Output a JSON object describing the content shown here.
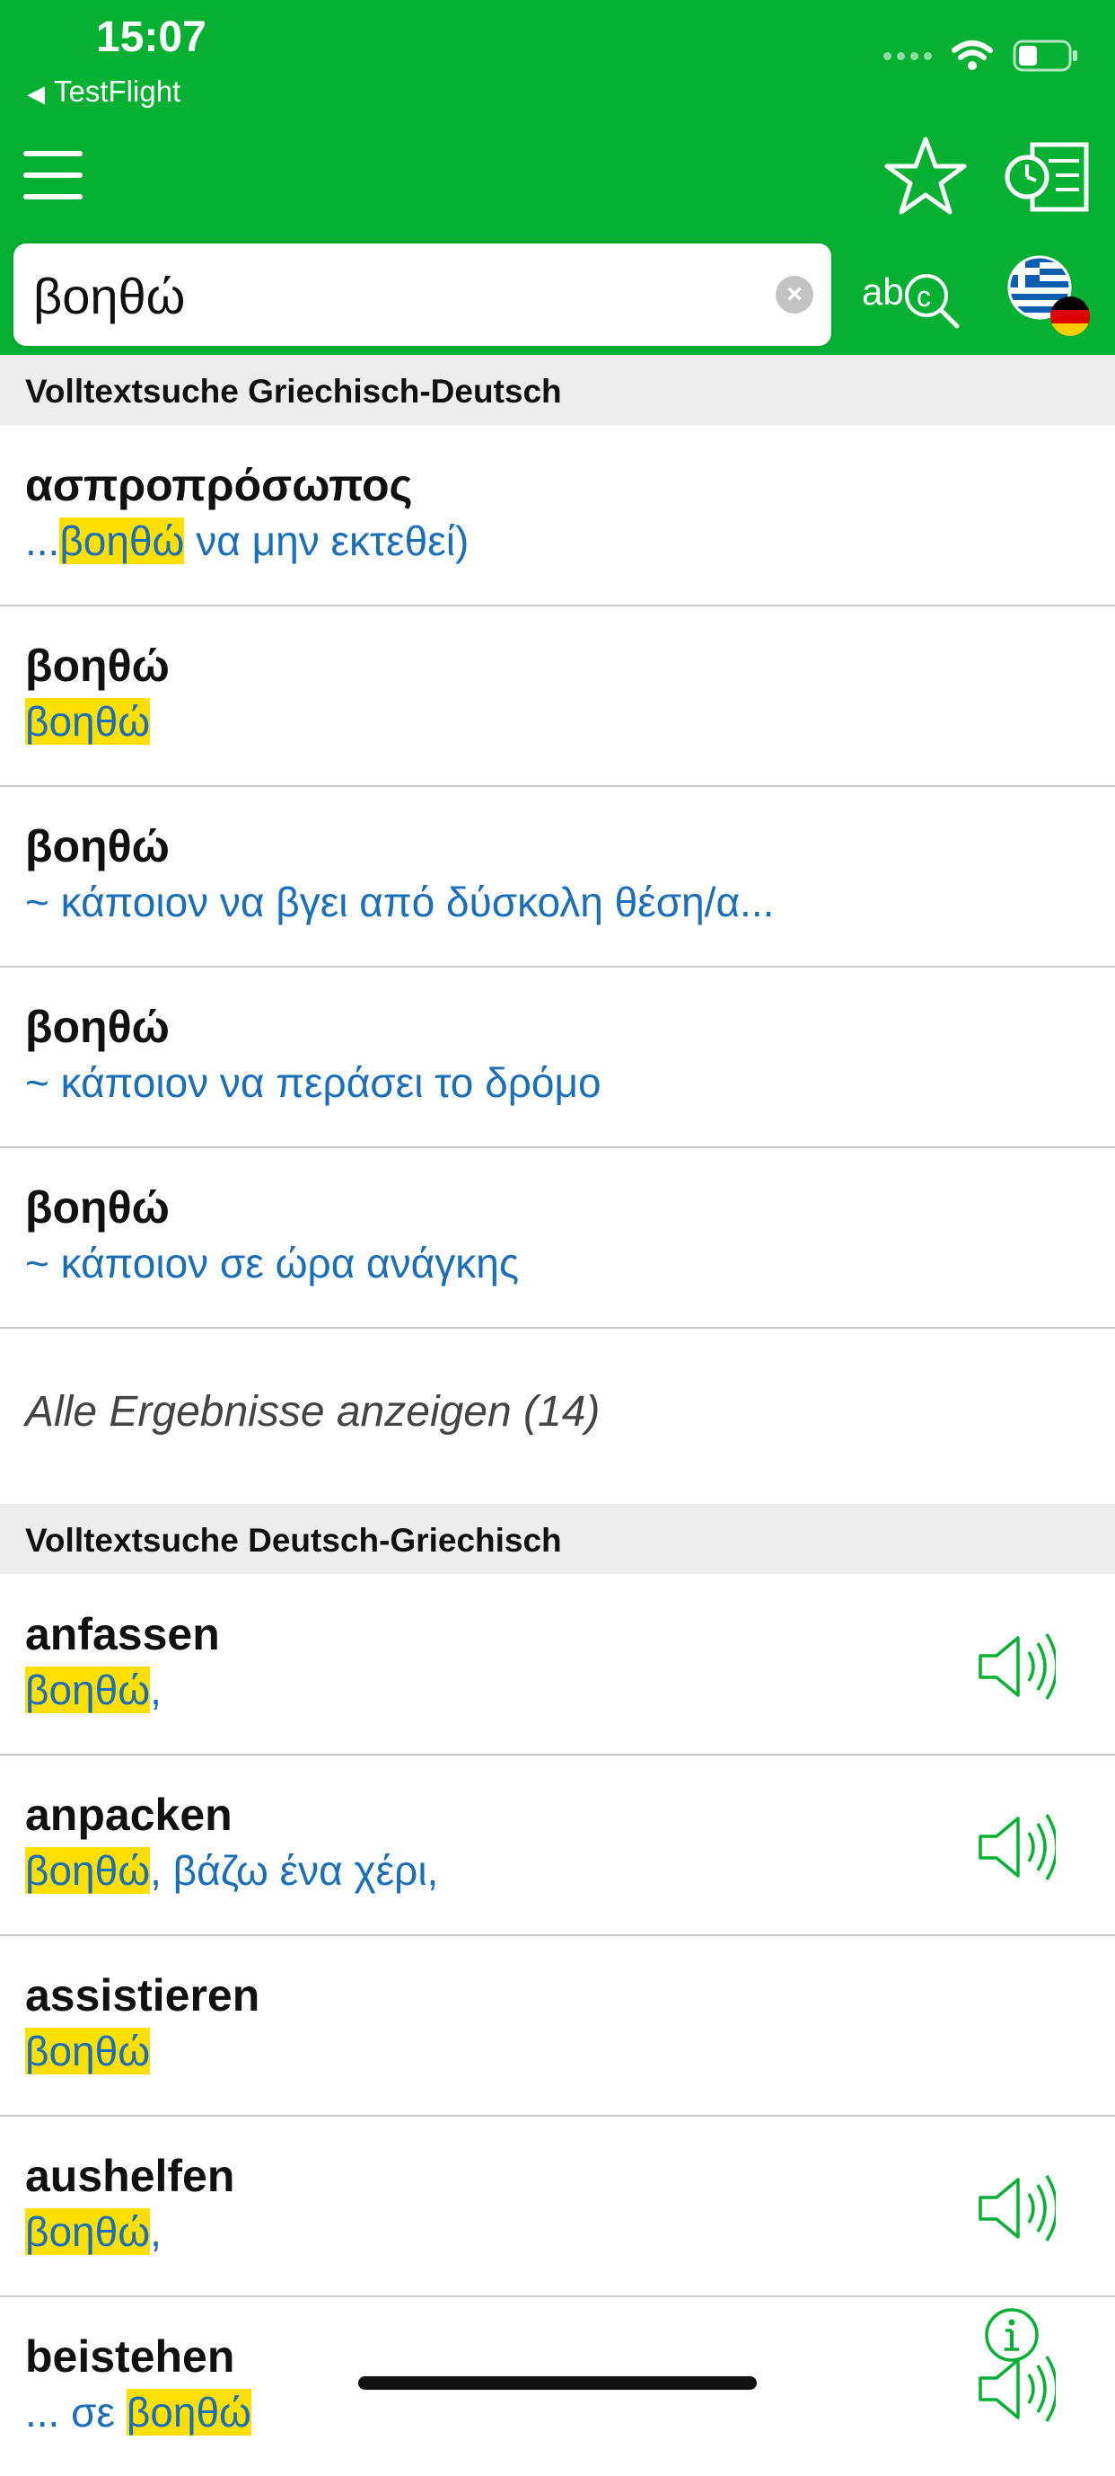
{
  "status_bar": {
    "time": "15:07",
    "back_app": "TestFlight"
  },
  "toolbar": {
    "menu_icon": "hamburger-icon",
    "favorites_icon": "star-icon",
    "history_icon": "history-icon"
  },
  "search": {
    "value": "βοηθώ",
    "clear_icon": "clear-icon",
    "spellcheck_icon": "abc-search-icon",
    "language_icon": "greek-german-flag-icon"
  },
  "colors": {
    "accent": "#06b033",
    "link": "#1a6fb8",
    "highlight": "#ffdf00"
  },
  "section_gr_de": {
    "title": "Volltextsuche Griechisch-Deutsch",
    "rows": [
      {
        "headword": "ασπροπρόσωπος",
        "pre": "...",
        "hl": "βοηθώ",
        "post": " να μην εκτεθεί)"
      },
      {
        "headword": "βοηθώ",
        "pre": "",
        "hl": "βοηθώ",
        "post": ""
      },
      {
        "headword": "βοηθώ",
        "pre": "~ κάποιον να βγει από δύσκολη θέση/α...",
        "hl": "",
        "post": ""
      },
      {
        "headword": "βοηθώ",
        "pre": "~ κάποιον να περάσει το δρόμο",
        "hl": "",
        "post": ""
      },
      {
        "headword": "βοηθώ",
        "pre": "~ κάποιον σε ώρα ανάγκης",
        "hl": "",
        "post": ""
      }
    ],
    "show_all": "Alle Ergebnisse anzeigen (14)"
  },
  "section_de_gr": {
    "title": "Volltextsuche Deutsch-Griechisch",
    "rows": [
      {
        "headword": "anfassen",
        "pre": "",
        "hl": "βοηθώ",
        "post": ",",
        "speaker": true
      },
      {
        "headword": "anpacken",
        "pre": "",
        "hl": "βοηθώ",
        "post": ", βάζω ένα χέρι,",
        "speaker": true
      },
      {
        "headword": "assistieren",
        "pre": "",
        "hl": "βοηθώ",
        "post": "",
        "speaker": false
      },
      {
        "headword": "aushelfen",
        "pre": "",
        "hl": "βοηθώ",
        "post": ",",
        "speaker": true
      },
      {
        "headword": "beistehen",
        "pre": "... σε ",
        "hl": "βοηθώ",
        "post": "",
        "speaker": true
      }
    ]
  }
}
